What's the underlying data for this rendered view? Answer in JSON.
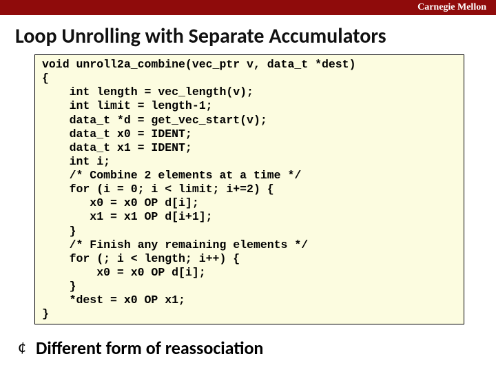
{
  "header": {
    "org": "Carnegie Mellon"
  },
  "title": "Loop Unrolling with Separate Accumulators",
  "code": "void unroll2a_combine(vec_ptr v, data_t *dest)\n{\n    int length = vec_length(v);\n    int limit = length-1;\n    data_t *d = get_vec_start(v);\n    data_t x0 = IDENT;\n    data_t x1 = IDENT;\n    int i;\n    /* Combine 2 elements at a time */\n    for (i = 0; i < limit; i+=2) {\n       x0 = x0 OP d[i];\n       x1 = x1 OP d[i+1];\n    }\n    /* Finish any remaining elements */\n    for (; i < length; i++) {\n        x0 = x0 OP d[i];\n    }\n    *dest = x0 OP x1;\n}",
  "bullet": {
    "glyph": "¢",
    "text": "Different form of reassociation"
  }
}
